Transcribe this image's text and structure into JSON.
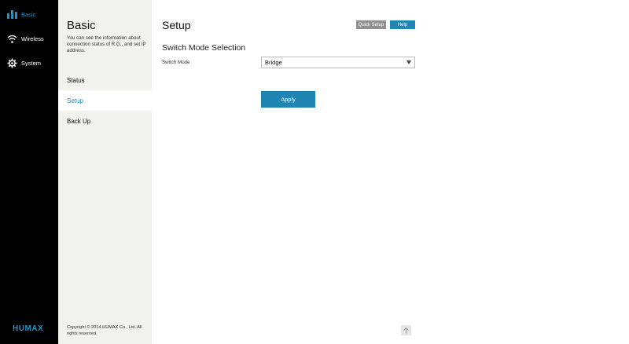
{
  "leftnav": {
    "items": [
      {
        "label": "Basic",
        "icon": "bar-chart-icon",
        "active": true
      },
      {
        "label": "Wireless",
        "icon": "wifi-icon",
        "active": false
      },
      {
        "label": "System",
        "icon": "gear-icon",
        "active": false
      }
    ],
    "logo": "HUMAX"
  },
  "subpanel": {
    "title": "Basic",
    "description": "You can see the information about connection status of R.G., and set IP address.",
    "items": [
      {
        "label": "Status"
      },
      {
        "label": "Setup",
        "selected": true
      },
      {
        "label": "Back Up"
      }
    ],
    "copyright": "Copyright © 2014 HUMAX Co., Ltd. All rights reserved."
  },
  "main": {
    "title": "Setup",
    "quick_setup_label": "Quick Setup",
    "help_label": "Help",
    "section_title": "Switch Mode Selection",
    "switch_mode_label": "Switch Mode",
    "switch_mode_value": "Bridge",
    "apply_label": "Apply"
  },
  "colors": {
    "accent": "#1f86b3",
    "active_text": "#2a8fbd",
    "nav_bg": "#000000",
    "subpanel_bg": "#f2f2ef"
  }
}
